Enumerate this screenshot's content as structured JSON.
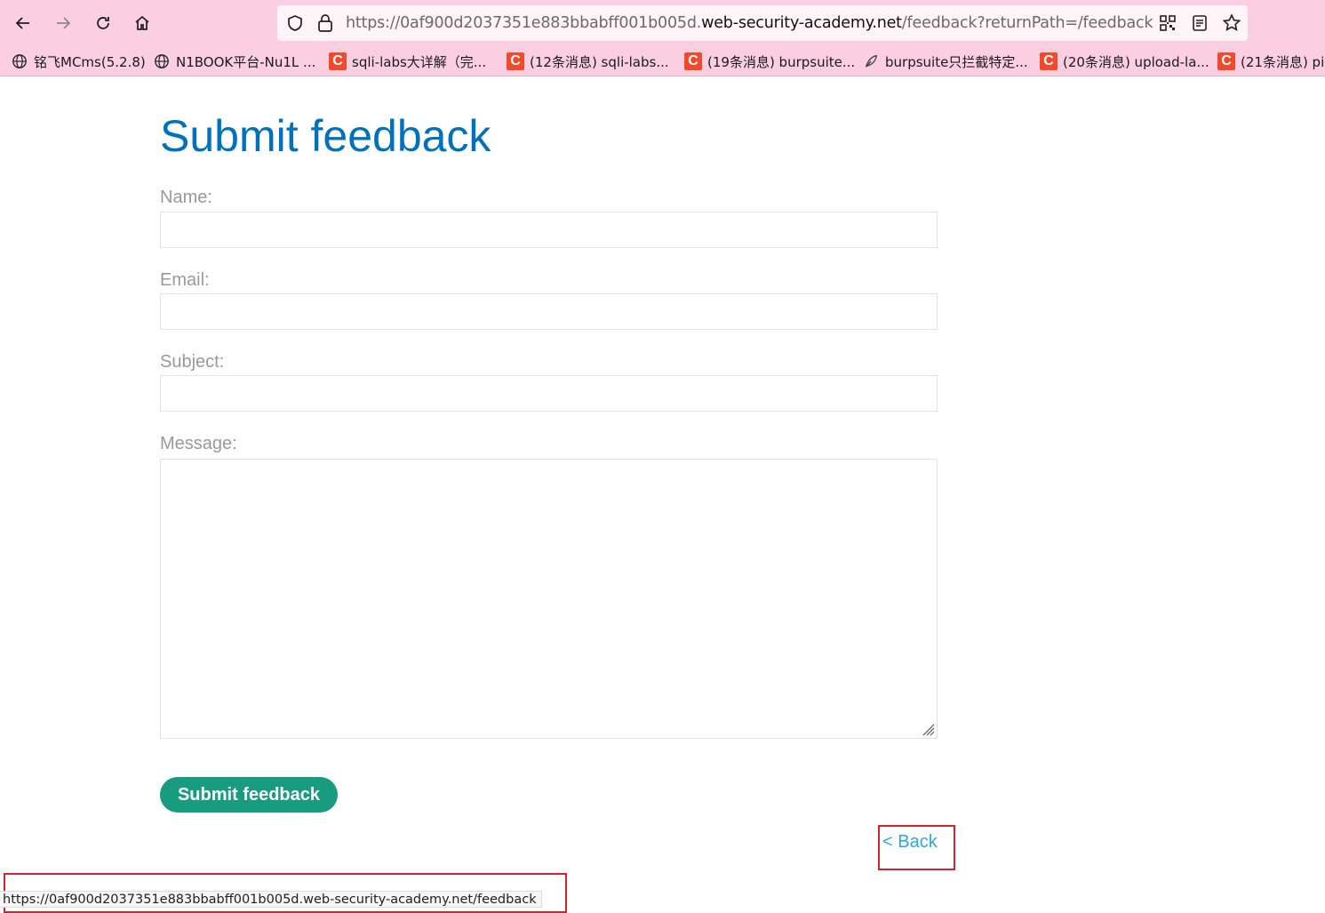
{
  "browser": {
    "url_prefix": "https://0af900d2037351e883bbabff001b005d.",
    "url_host": "web-security-academy.net",
    "url_suffix": "/feedback?returnPath=/feedback",
    "status_url": "https://0af900d2037351e883bbabff001b005d.web-security-academy.net/feedback"
  },
  "bookmarks": [
    {
      "label": "铭飞MCms(5.2.8)",
      "icon": "globe-icon"
    },
    {
      "label": "N1BOOK平台-Nu1L ...",
      "icon": "globe-icon"
    },
    {
      "label": "sqli-labs大详解（完...",
      "icon": "csdn-icon"
    },
    {
      "label": "(12条消息) sqli-labs...",
      "icon": "csdn-icon"
    },
    {
      "label": "(19条消息) burpsuite...",
      "icon": "csdn-icon"
    },
    {
      "label": "burpsuite只拦截特定...",
      "icon": "feather-icon"
    },
    {
      "label": "(20条消息) upload-la...",
      "icon": "csdn-icon"
    },
    {
      "label": "(21条消息) pi",
      "icon": "csdn-icon"
    }
  ],
  "page": {
    "title": "Submit feedback",
    "fields": {
      "name_label": "Name:",
      "email_label": "Email:",
      "subject_label": "Subject:",
      "message_label": "Message:"
    },
    "submit_label": "Submit feedback",
    "back_label": "< Back"
  },
  "colors": {
    "title": "#0071bc",
    "submit_button": "#179c7f",
    "back_link": "#2ba8e0",
    "highlight_box": "#d9212c",
    "chrome_background": "#fbcfe0"
  }
}
